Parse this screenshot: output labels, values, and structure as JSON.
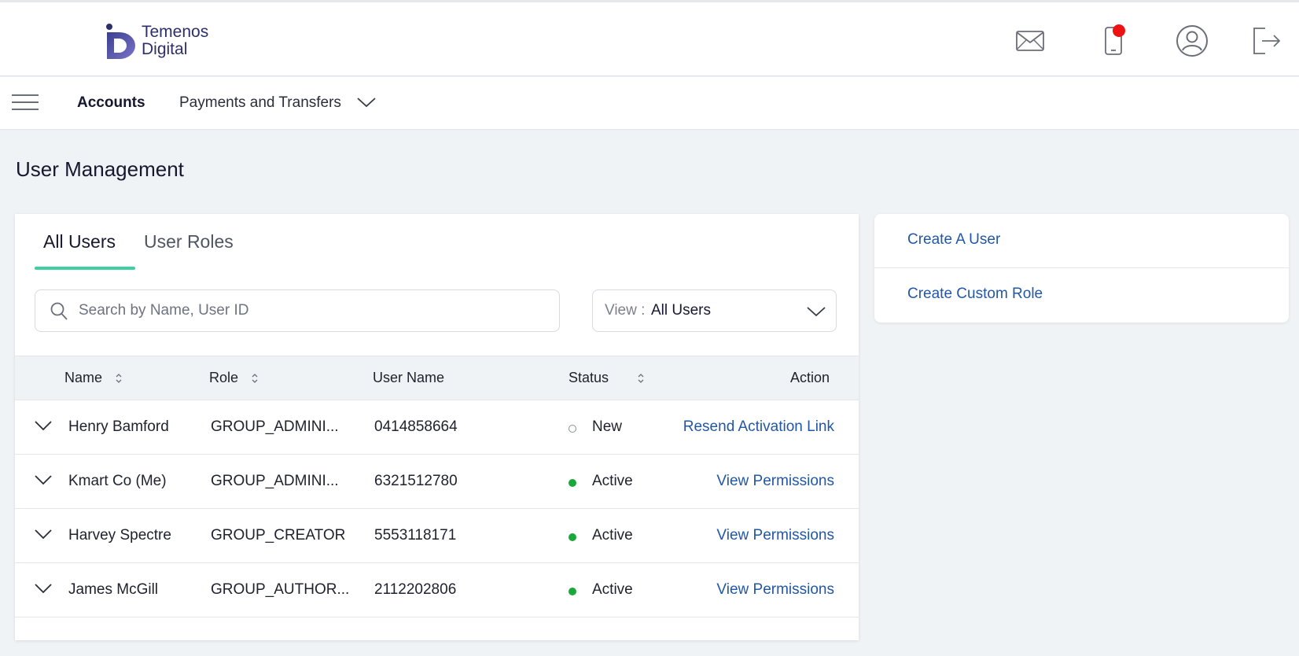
{
  "brand": {
    "line1": "Temenos",
    "line2": "Digital",
    "color": "#2c2f6b"
  },
  "header_icons": [
    "mail-icon",
    "mobile-notification-icon",
    "user-profile-icon",
    "logout-icon"
  ],
  "nav": {
    "accounts": "Accounts",
    "payments": "Payments and Transfers"
  },
  "page_title": "User Management",
  "tabs": [
    {
      "label": "All Users",
      "active": true
    },
    {
      "label": "User Roles",
      "active": false
    }
  ],
  "search": {
    "placeholder": "Search by Name, User ID",
    "value": ""
  },
  "view_filter": {
    "label": "View :",
    "value": "All Users"
  },
  "table": {
    "headers": {
      "name": "Name",
      "role": "Role",
      "username": "User Name",
      "status": "Status",
      "action": "Action"
    },
    "rows": [
      {
        "name": "Henry Bamford",
        "role": "GROUP_ADMINI...",
        "username": "0414858664",
        "status": "New",
        "action": "Resend Activation Link"
      },
      {
        "name": "Kmart Co (Me)",
        "role": "GROUP_ADMINI...",
        "username": "6321512780",
        "status": "Active",
        "action": "View Permissions"
      },
      {
        "name": "Harvey Spectre",
        "role": "GROUP_CREATOR",
        "username": "5553118171",
        "status": "Active",
        "action": "View Permissions"
      },
      {
        "name": "James McGill",
        "role": "GROUP_AUTHOR...",
        "username": "2112202806",
        "status": "Active",
        "action": "View Permissions"
      }
    ]
  },
  "side_actions": {
    "create_user": "Create A User",
    "create_role": "Create Custom Role"
  },
  "colors": {
    "accent_tab": "#3dd0a1",
    "link": "#2257a6",
    "active_status": "#1aa83a",
    "notification": "#ee1111",
    "background": "#f0f3f6"
  }
}
